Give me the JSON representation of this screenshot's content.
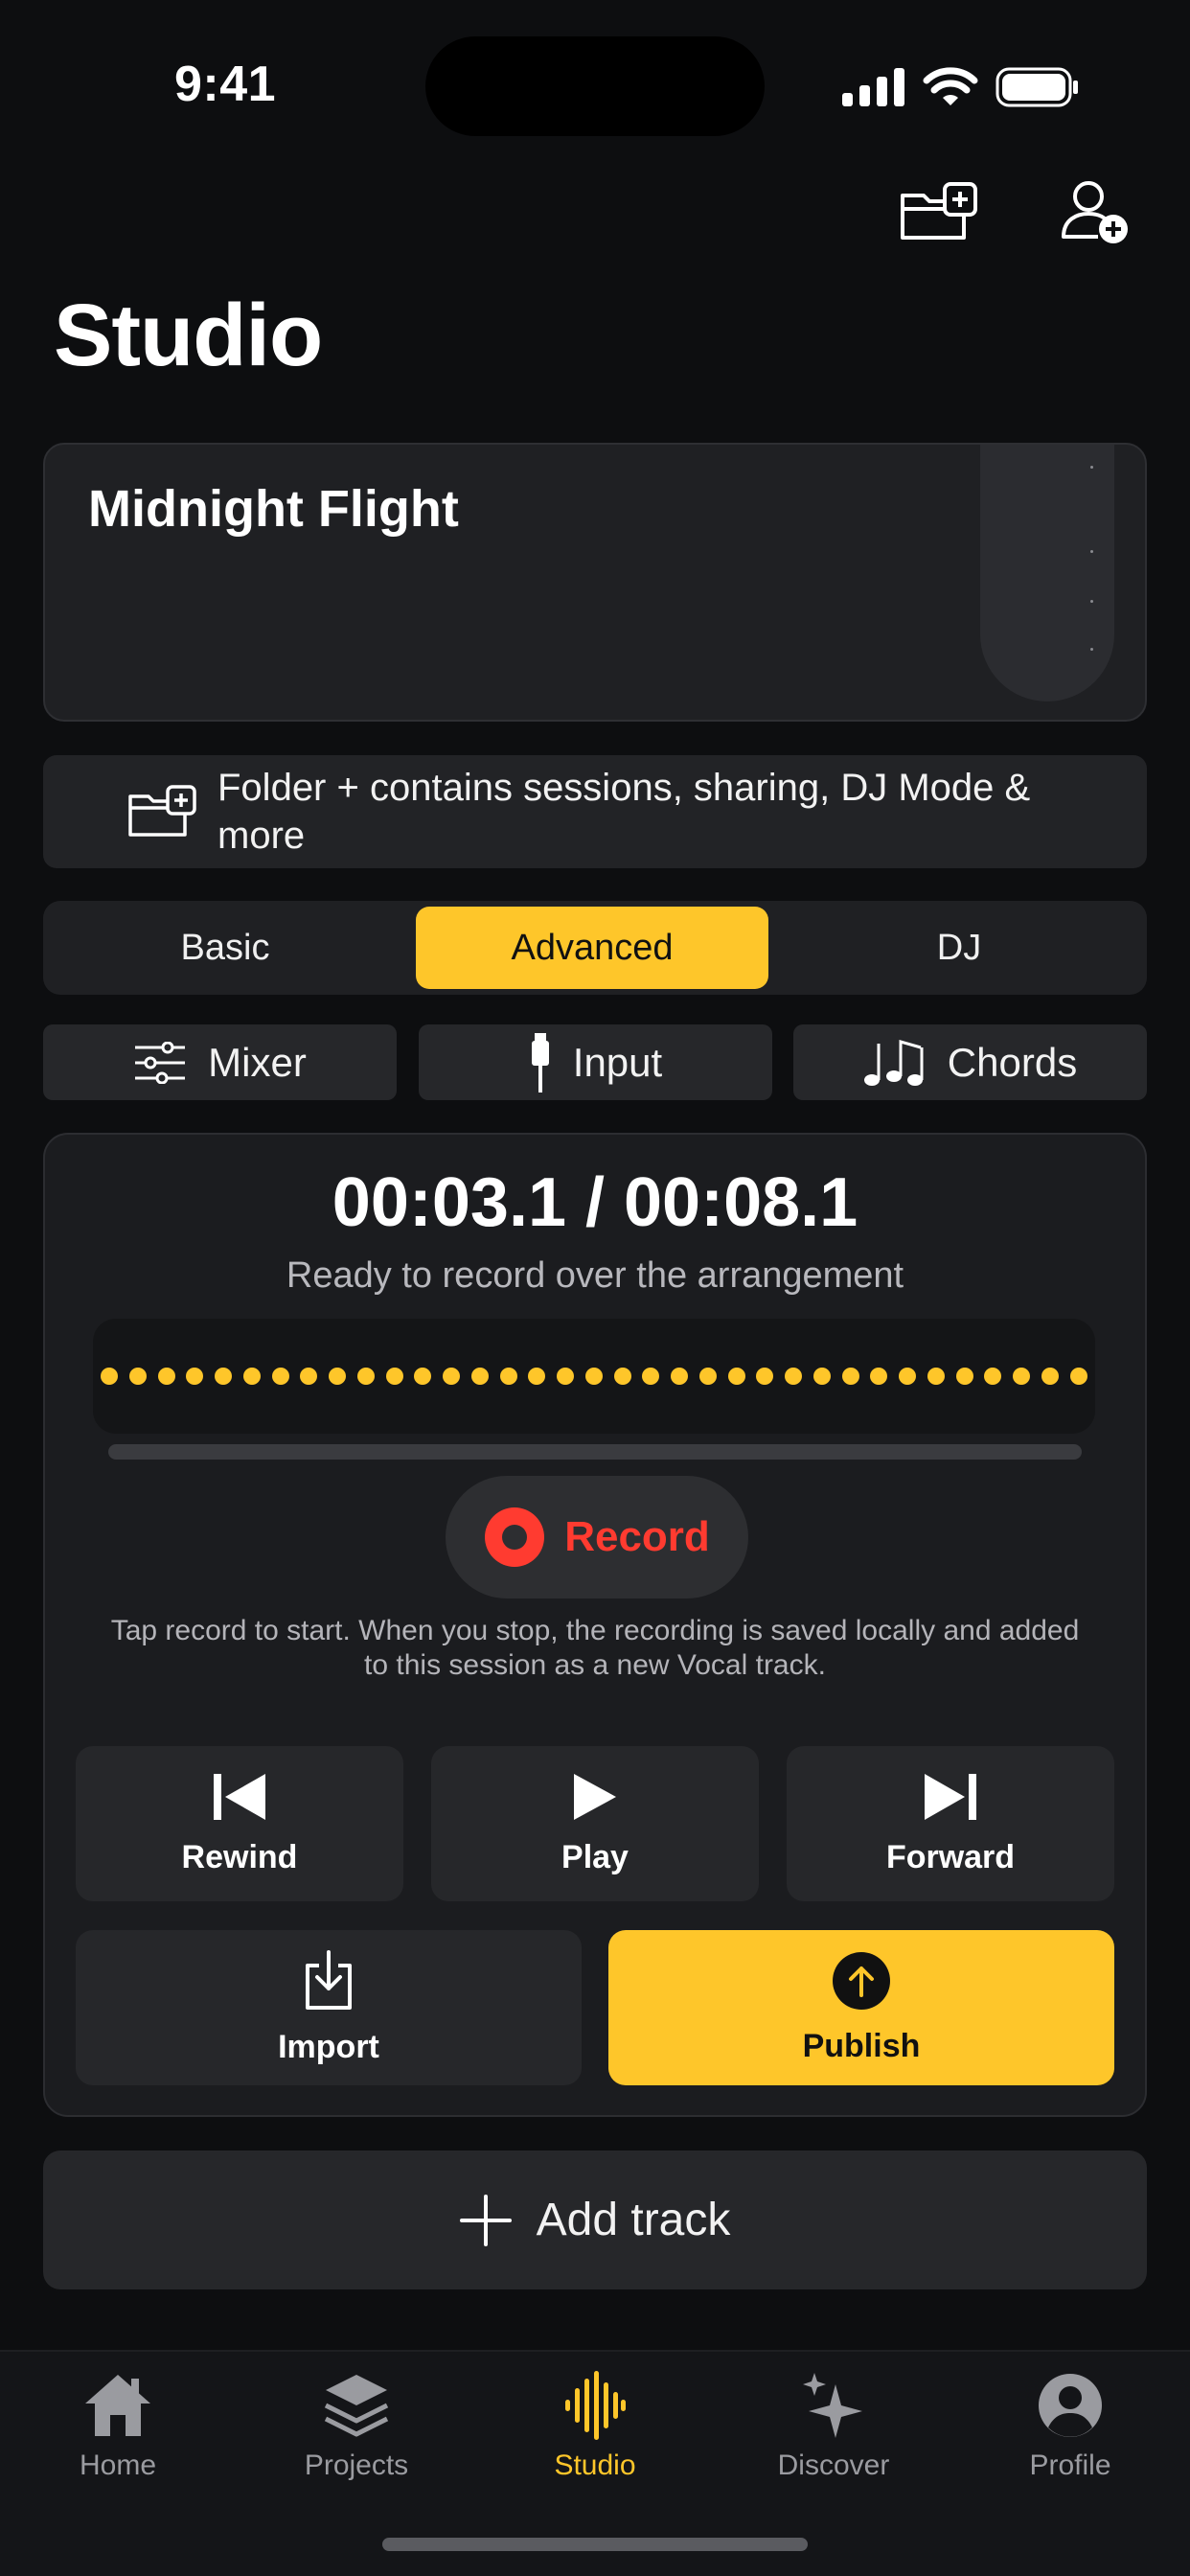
{
  "status_bar": {
    "time": "9:41"
  },
  "page": {
    "title": "Studio"
  },
  "project": {
    "title": "Midnight Flight"
  },
  "banner": {
    "text": "Folder + contains sessions, sharing, DJ Mode & more"
  },
  "modes": {
    "items": [
      "Basic",
      "Advanced",
      "DJ"
    ],
    "selected": "Advanced"
  },
  "tools": {
    "mixer": "Mixer",
    "input": "Input",
    "chords": "Chords"
  },
  "recorder": {
    "timecode": "00:03.1 / 00:08.1",
    "subtitle": "Ready to record over the arrangement",
    "waveform_dot_count": 35,
    "progress": 0.0,
    "record_label": "Record",
    "help_text": "Tap record to start. When you stop, the recording is saved locally and added to this session as a new Vocal track.",
    "rewind_label": "Rewind",
    "play_label": "Play",
    "forward_label": "Forward",
    "import_label": "Import",
    "publish_label": "Publish"
  },
  "add_track_label": "Add track",
  "tabs": [
    {
      "label": "Home",
      "icon": "home-icon",
      "active": false
    },
    {
      "label": "Projects",
      "icon": "layers-icon",
      "active": false
    },
    {
      "label": "Studio",
      "icon": "waveform-icon",
      "active": true
    },
    {
      "label": "Discover",
      "icon": "sparkles-icon",
      "active": false
    },
    {
      "label": "Profile",
      "icon": "person-circle-icon",
      "active": false
    }
  ],
  "colors": {
    "accent": "#fec62a",
    "record": "#ff3b30",
    "background": "#0d0e10",
    "surface": "#1f2023"
  }
}
